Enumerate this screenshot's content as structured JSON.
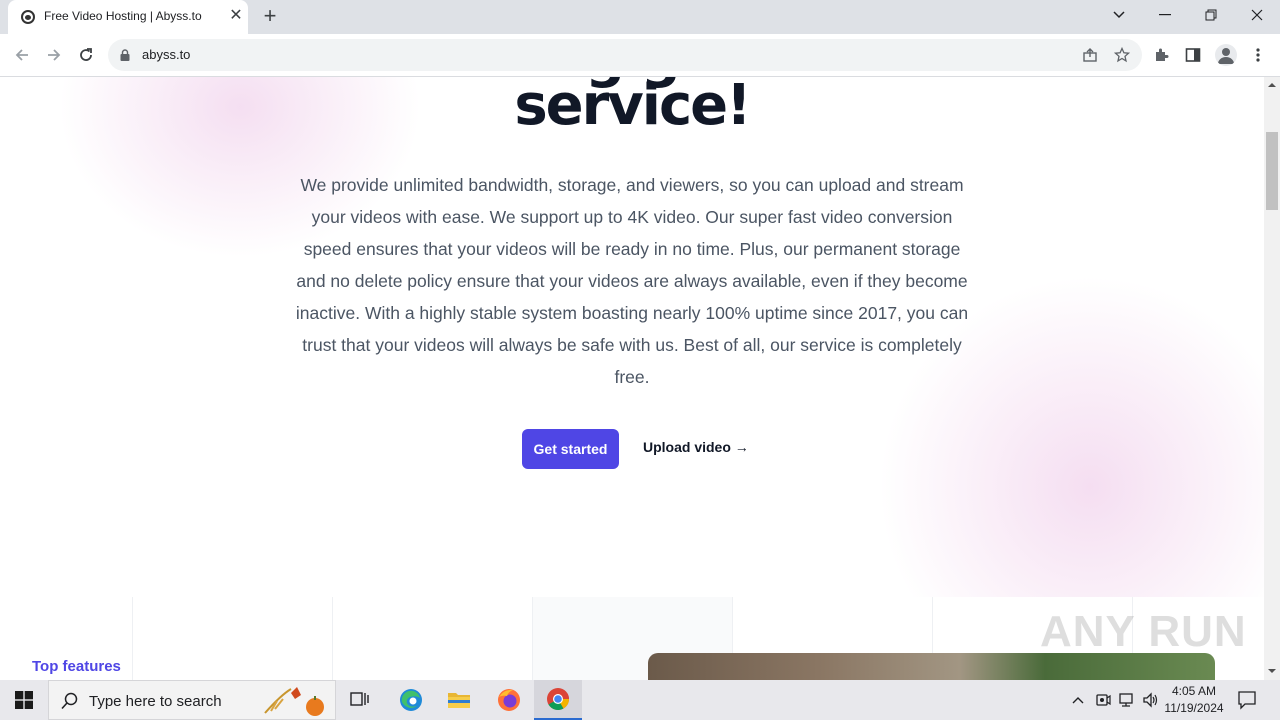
{
  "browser": {
    "tab_title": "Free Video Hosting | Abyss.to",
    "tab_close": "✕",
    "new_tab": "+",
    "url": "abyss.to"
  },
  "hero": {
    "title_partial": "g                    g",
    "title_line": "service!",
    "description": "We provide unlimited bandwidth, storage, and viewers, so you can upload and stream your videos with ease. We support up to 4K video. Our super fast video conversion speed ensures that your videos will be ready in no time. Plus, our permanent storage and no delete policy ensure that your videos are always available, even if they become inactive. With a highly stable system boasting nearly 100% uptime since 2017, you can trust that your videos will always be safe with us. Best of all, our service is completely free.",
    "primary_button": "Get started",
    "secondary_link": "Upload video →"
  },
  "features": {
    "heading": "Top features"
  },
  "watermark": "ANY RUN",
  "taskbar": {
    "search_placeholder": "Type here to search",
    "time": "4:05 AM",
    "date": "11/19/2024"
  },
  "colors": {
    "accent": "#4f46e5",
    "heading": "#111827",
    "body_text": "#4b5563"
  },
  "icons": [
    "back-icon",
    "forward-icon",
    "reload-icon",
    "lock-icon",
    "share-icon",
    "star-icon",
    "extensions-icon",
    "side-panel-icon",
    "profile-icon",
    "more-icon",
    "windows-start-icon",
    "search-icon",
    "task-view-icon",
    "edge-icon",
    "file-explorer-icon",
    "firefox-icon",
    "chrome-icon",
    "chevron-up-icon",
    "network-icon",
    "volume-icon",
    "notification-icon"
  ]
}
